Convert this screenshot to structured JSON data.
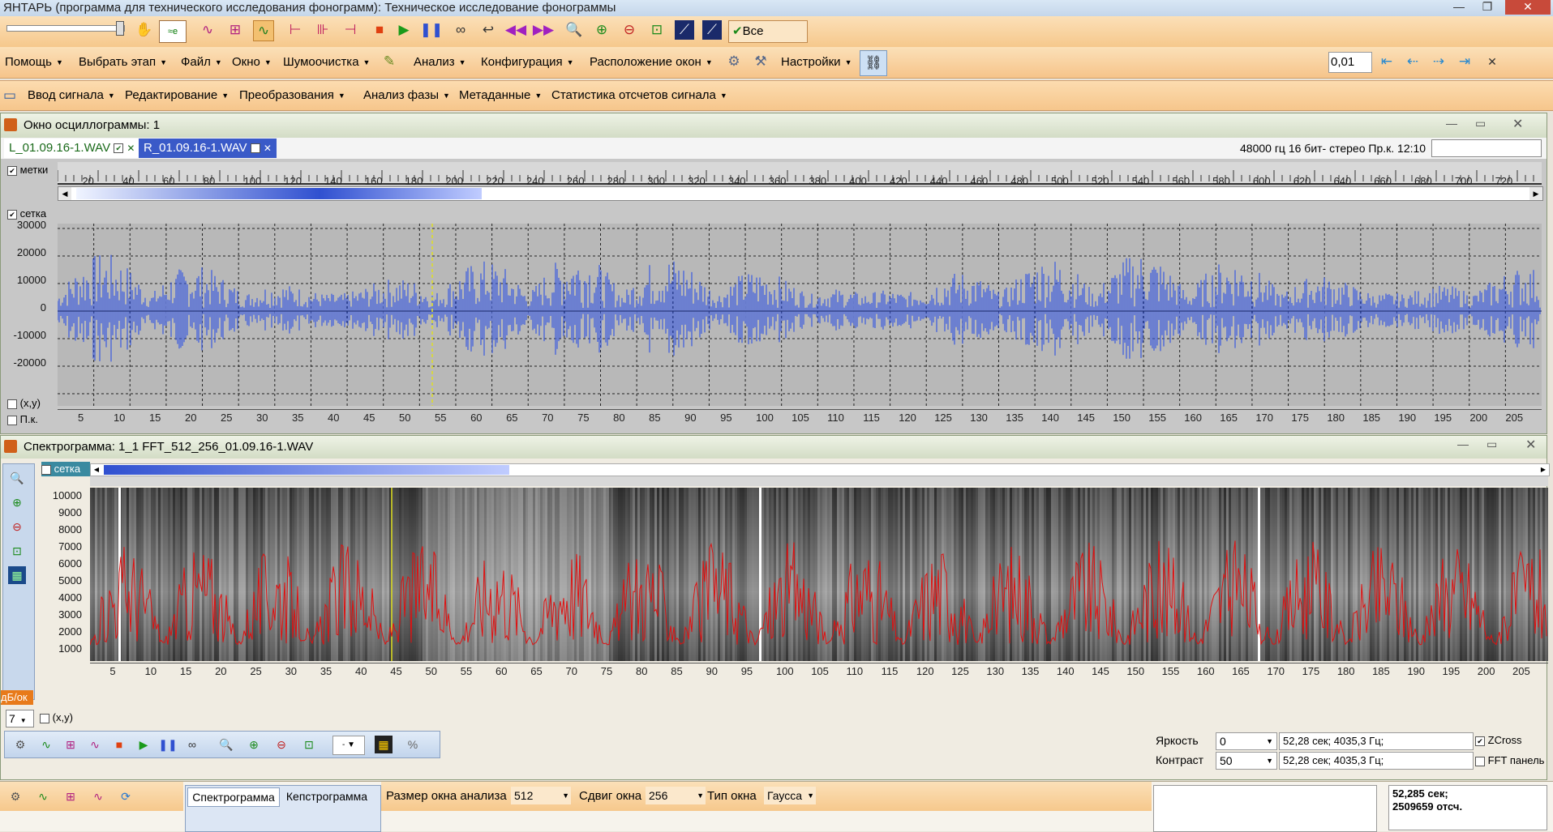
{
  "app_title": "ЯНТАРЬ (программа для технического исследования фонограмм): Техническое исследование фонограммы",
  "toolbar": {
    "marks_label": "Все метки",
    "step_value": "0,01"
  },
  "main_menu": [
    {
      "label": "Помощь"
    },
    {
      "label": "Выбрать этап"
    },
    {
      "label": "Файл"
    },
    {
      "label": "Окно"
    },
    {
      "label": "Шумоочистка"
    },
    {
      "label": "Анализ"
    },
    {
      "label": "Конфигурация"
    },
    {
      "label": "Расположение окон"
    },
    {
      "label": "Настройки"
    }
  ],
  "sub_menu": [
    {
      "label": "Ввод сигнала"
    },
    {
      "label": "Редактирование"
    },
    {
      "label": "Преобразования"
    },
    {
      "label": "Анализ фазы"
    },
    {
      "label": "Метаданные"
    },
    {
      "label": "Статистика отсчетов сигнала"
    }
  ],
  "osc": {
    "title": "Окно осциллограммы: 1",
    "tab_left": "L_01.09.16-1.WAV",
    "tab_right": "R_01.09.16-1.WAV",
    "info": "48000 гц 16 бит- стерео Пр.к. 12:10",
    "marks_label": "метки",
    "grid_label": "сетка",
    "xy_label": "(x,y)",
    "pk_label": "П.к.",
    "top_ticks": [
      "20",
      "40",
      "60",
      "80",
      "100",
      "120",
      "140",
      "160",
      "180",
      "200",
      "220",
      "240",
      "260",
      "280",
      "300",
      "320",
      "340",
      "360",
      "380",
      "400",
      "420",
      "440",
      "460",
      "480",
      "500",
      "520",
      "540",
      "560",
      "580",
      "600",
      "620",
      "640",
      "660",
      "680",
      "700",
      "720"
    ],
    "y_ticks": [
      "30000",
      "20000",
      "10000",
      "0",
      "-10000",
      "-20000"
    ],
    "x_ticks": [
      "5",
      "10",
      "15",
      "20",
      "25",
      "30",
      "35",
      "40",
      "45",
      "50",
      "55",
      "60",
      "65",
      "70",
      "75",
      "80",
      "85",
      "90",
      "95",
      "100",
      "105",
      "110",
      "115",
      "120",
      "125",
      "130",
      "135",
      "140",
      "145",
      "150",
      "155",
      "160",
      "165",
      "170",
      "175",
      "180",
      "185",
      "190",
      "195",
      "200",
      "205"
    ]
  },
  "spec": {
    "title": "Спектрограмма: 1_1  FFT_512_256_01.09.16-1.WAV",
    "grid_label": "сетка",
    "db_label": "дБ/ок",
    "scale_value": "7",
    "xy_label": "(x,y)",
    "y_ticks": [
      "10000",
      "9000",
      "8000",
      "7000",
      "6000",
      "5000",
      "4000",
      "3000",
      "2000",
      "1000"
    ],
    "x_ticks": [
      "5",
      "10",
      "15",
      "20",
      "25",
      "30",
      "35",
      "40",
      "45",
      "50",
      "55",
      "60",
      "65",
      "70",
      "75",
      "80",
      "85",
      "90",
      "95",
      "100",
      "105",
      "110",
      "115",
      "120",
      "125",
      "130",
      "135",
      "140",
      "145",
      "150",
      "155",
      "160",
      "165",
      "170",
      "175",
      "180",
      "185",
      "190",
      "195",
      "200",
      "205"
    ],
    "brightness_label": "Яркость",
    "brightness_value": "0",
    "contrast_label": "Контраст",
    "contrast_value": "50",
    "readout1": "52,28 сек; 4035,3 Гц;",
    "readout2": "52,28 сек; 4035,3 Гц;",
    "zcross_label": "ZCross",
    "fft_panel_label": "FFT панель"
  },
  "bottom": {
    "tab_spectrogram": "Спектрограмма",
    "tab_cepstrogram": "Кепстрограмма",
    "window_size_label": "Размер окна анализа",
    "window_size_value": "512",
    "shift_label": "Сдвиг окна",
    "shift_value": "256",
    "window_type_label": "Тип окна",
    "window_type_value": "Гаусса",
    "status_time": "52,285 сек;",
    "status_samples": "2509659 отсч."
  }
}
